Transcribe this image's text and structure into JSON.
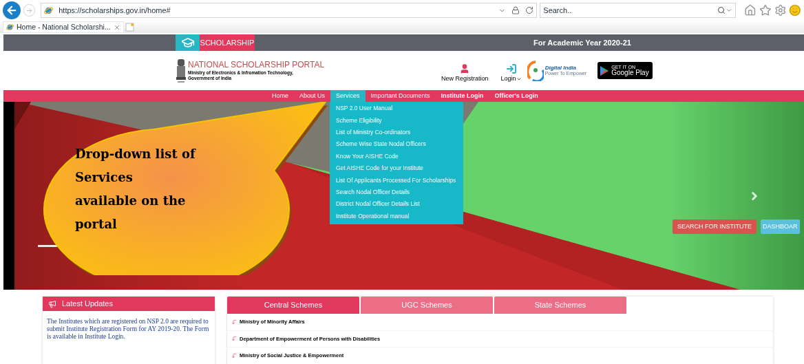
{
  "browser": {
    "url": "https://scholarships.gov.in/home#",
    "search_placeholder": "Search..",
    "tab_title": "Home - National Scholarshi..."
  },
  "topbar": {
    "brand": "SCHOLARSHIP",
    "academic_year": "For Academic Year 2020-21"
  },
  "header": {
    "title": "NATIONAL SCHOLARSHIP PORTAL",
    "subtitle": [
      "Ministry of Electronics & Infromation Technology,",
      "Government of India"
    ],
    "new_registration": "New Registration",
    "login": "Login",
    "digital_india": {
      "name": "Digital India",
      "tagline": "Power To Empower"
    },
    "play_badge": {
      "top": "GET IT ON",
      "name": "Google Play"
    }
  },
  "nav": [
    {
      "label": "Home",
      "selected": false,
      "bold": false
    },
    {
      "label": "About Us",
      "selected": false,
      "bold": false
    },
    {
      "label": "Services",
      "selected": true,
      "bold": false
    },
    {
      "label": "Important Documents",
      "selected": false,
      "bold": false
    },
    {
      "label": "Institute Login",
      "selected": false,
      "bold": true
    },
    {
      "label": "Officer's Login",
      "selected": false,
      "bold": true
    }
  ],
  "services_menu": [
    "NSP 2.0 User Manual",
    "Scheme Eligibility",
    "List of Ministry Co-ordinators",
    "Scheme Wise State Nodal Officers",
    "Know Your AISHE Code",
    "Get AISHE Code for your Institute",
    "List Of Applicants Processed For Scholarships",
    "Search Nodal Officer Details",
    "District Nodal Officer Details List",
    "Institute Operational manual"
  ],
  "banner": {
    "kind": "picture",
    "buttons": [
      {
        "label": "SEARCH FOR INSTITUTE",
        "kind": "search"
      },
      {
        "label": "DASHBOAR",
        "kind": "dashboard"
      }
    ]
  },
  "callout": {
    "text": "Drop-down list of Services available on the portal"
  },
  "updates": {
    "title": "Latest Updates",
    "text": "The Institutes which are registered on NSP 2.0 are required to submit Institute Registration Form for AY 2019-20. The Form is available in Institute Login."
  },
  "scheme_tabs": [
    {
      "label": "Central Schemes",
      "selected": true
    },
    {
      "label": "UGC Schemes",
      "selected": false
    },
    {
      "label": "State Schemes",
      "selected": false
    }
  ],
  "schemes": [
    "Ministry of Minority Affairs",
    "Department of Empowerment of Persons with Disabilities",
    "Ministry of Social Justice & Empowerment"
  ]
}
